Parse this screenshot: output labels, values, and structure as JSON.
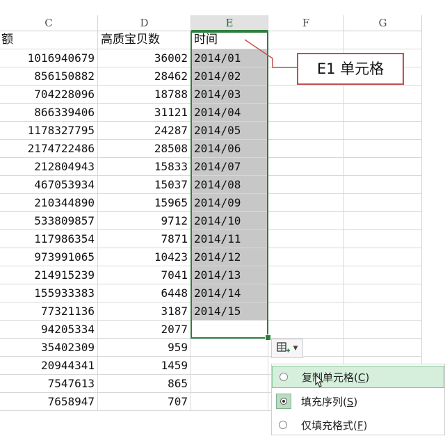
{
  "columns": {
    "c": "C",
    "d": "D",
    "e": "E",
    "f": "F",
    "g": "G"
  },
  "header_row": {
    "c": "额",
    "d": "高质宝贝数",
    "e": "时间"
  },
  "rows": [
    {
      "c": "1016940679",
      "d": "36002",
      "e": "2014/01"
    },
    {
      "c": "856150882",
      "d": "28462",
      "e": "2014/02"
    },
    {
      "c": "704228096",
      "d": "18788",
      "e": "2014/03"
    },
    {
      "c": "866339406",
      "d": "31121",
      "e": "2014/04"
    },
    {
      "c": "1178327795",
      "d": "24287",
      "e": "2014/05"
    },
    {
      "c": "2174722486",
      "d": "28508",
      "e": "2014/06"
    },
    {
      "c": "212804943",
      "d": "15833",
      "e": "2014/07"
    },
    {
      "c": "467053934",
      "d": "15037",
      "e": "2014/08"
    },
    {
      "c": "210344890",
      "d": "15965",
      "e": "2014/09"
    },
    {
      "c": "533809857",
      "d": "9712",
      "e": "2014/10"
    },
    {
      "c": "117986354",
      "d": "7871",
      "e": "2014/11"
    },
    {
      "c": "973991065",
      "d": "10423",
      "e": "2014/12"
    },
    {
      "c": "214915239",
      "d": "7041",
      "e": "2014/13"
    },
    {
      "c": "155933383",
      "d": "6448",
      "e": "2014/14"
    },
    {
      "c": "77321136",
      "d": "3187",
      "e": "2014/15"
    },
    {
      "c": "94205334",
      "d": "2077",
      "e": ""
    },
    {
      "c": "35402309",
      "d": "959",
      "e": ""
    },
    {
      "c": "20944341",
      "d": "1459",
      "e": ""
    },
    {
      "c": "7547613",
      "d": "865",
      "e": ""
    },
    {
      "c": "7658947",
      "d": "707",
      "e": ""
    }
  ],
  "callout": "E1 单元格",
  "autofill_menu": {
    "items": [
      {
        "label": "复制单元格",
        "key": "C",
        "selected": false,
        "hover": true
      },
      {
        "label": "填充序列",
        "key": "S",
        "selected": true,
        "hover": false
      },
      {
        "label": "仅填充格式",
        "key": "F",
        "selected": false,
        "hover": false
      }
    ]
  },
  "colors": {
    "selection": "#2e7d3e",
    "shade": "#c7c7c7",
    "callout_border": "#c0504d",
    "menu_hover": "#d6efdc"
  }
}
